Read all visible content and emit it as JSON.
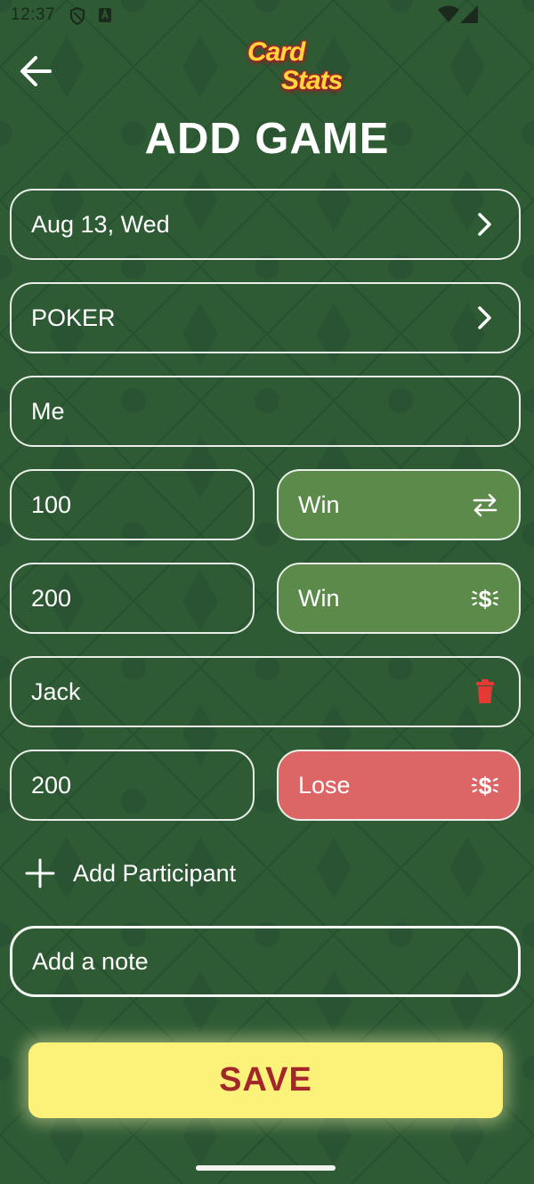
{
  "status_bar": {
    "time": "12:37",
    "icons": [
      "shield-icon",
      "a-badge-icon",
      "wifi-icon",
      "signal-icon"
    ]
  },
  "header": {
    "logo_line1": "Card",
    "logo_line2": "Stats",
    "title": "ADD GAME",
    "back_icon": "arrow-left-icon"
  },
  "form": {
    "date": "Aug 13, Wed",
    "game_type": "POKER",
    "player_name": "Me",
    "buy_in": "100",
    "buy_in_result": "Win",
    "amount": "200",
    "amount_result": "Win",
    "participant_name": "Jack",
    "participant_amount": "200",
    "participant_result": "Lose",
    "add_participant_label": "Add Participant",
    "note_placeholder": "Add a note",
    "save_label": "SAVE"
  },
  "colors": {
    "background": "#2d5a33",
    "win": "#5b8a4a",
    "lose": "#dc6566",
    "save_bg": "#fdf279",
    "save_text": "#a3272a",
    "delete": "#e53935"
  }
}
